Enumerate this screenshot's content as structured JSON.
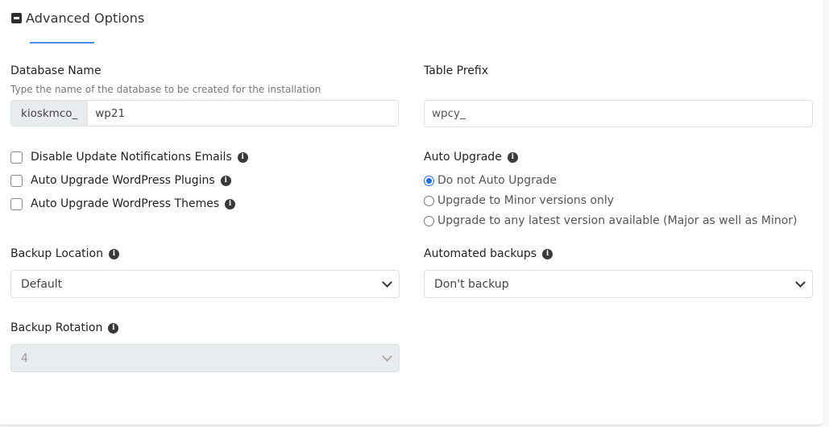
{
  "section": {
    "title": "Advanced Options",
    "toggle_icon": "minus-square-icon",
    "accent_color": "#4a8fe7"
  },
  "database_name": {
    "label": "Database Name",
    "hint": "Type the name of the database to be created for the installation",
    "prefix": "kioskmco_",
    "value": "wp21"
  },
  "table_prefix": {
    "label": "Table Prefix",
    "value": "wpcy_"
  },
  "checkboxes": [
    {
      "label": "Disable Update Notifications Emails",
      "checked": false,
      "icon": "info-icon"
    },
    {
      "label": "Auto Upgrade WordPress Plugins",
      "checked": false,
      "icon": "info-icon"
    },
    {
      "label": "Auto Upgrade WordPress Themes",
      "checked": false,
      "icon": "info-icon"
    }
  ],
  "auto_upgrade": {
    "label": "Auto Upgrade",
    "options": [
      {
        "label": "Do not Auto Upgrade",
        "selected": true
      },
      {
        "label": "Upgrade to Minor versions only",
        "selected": false
      },
      {
        "label": "Upgrade to any latest version available (Major as well as Minor)",
        "selected": false
      }
    ],
    "selected_color": "#1a6ef5"
  },
  "backup_location": {
    "label": "Backup Location",
    "selected": "Default"
  },
  "automated_backups": {
    "label": "Automated backups",
    "selected": "Don't backup"
  },
  "backup_rotation": {
    "label": "Backup Rotation",
    "selected": "4",
    "disabled": true
  },
  "info_glyph": "i"
}
